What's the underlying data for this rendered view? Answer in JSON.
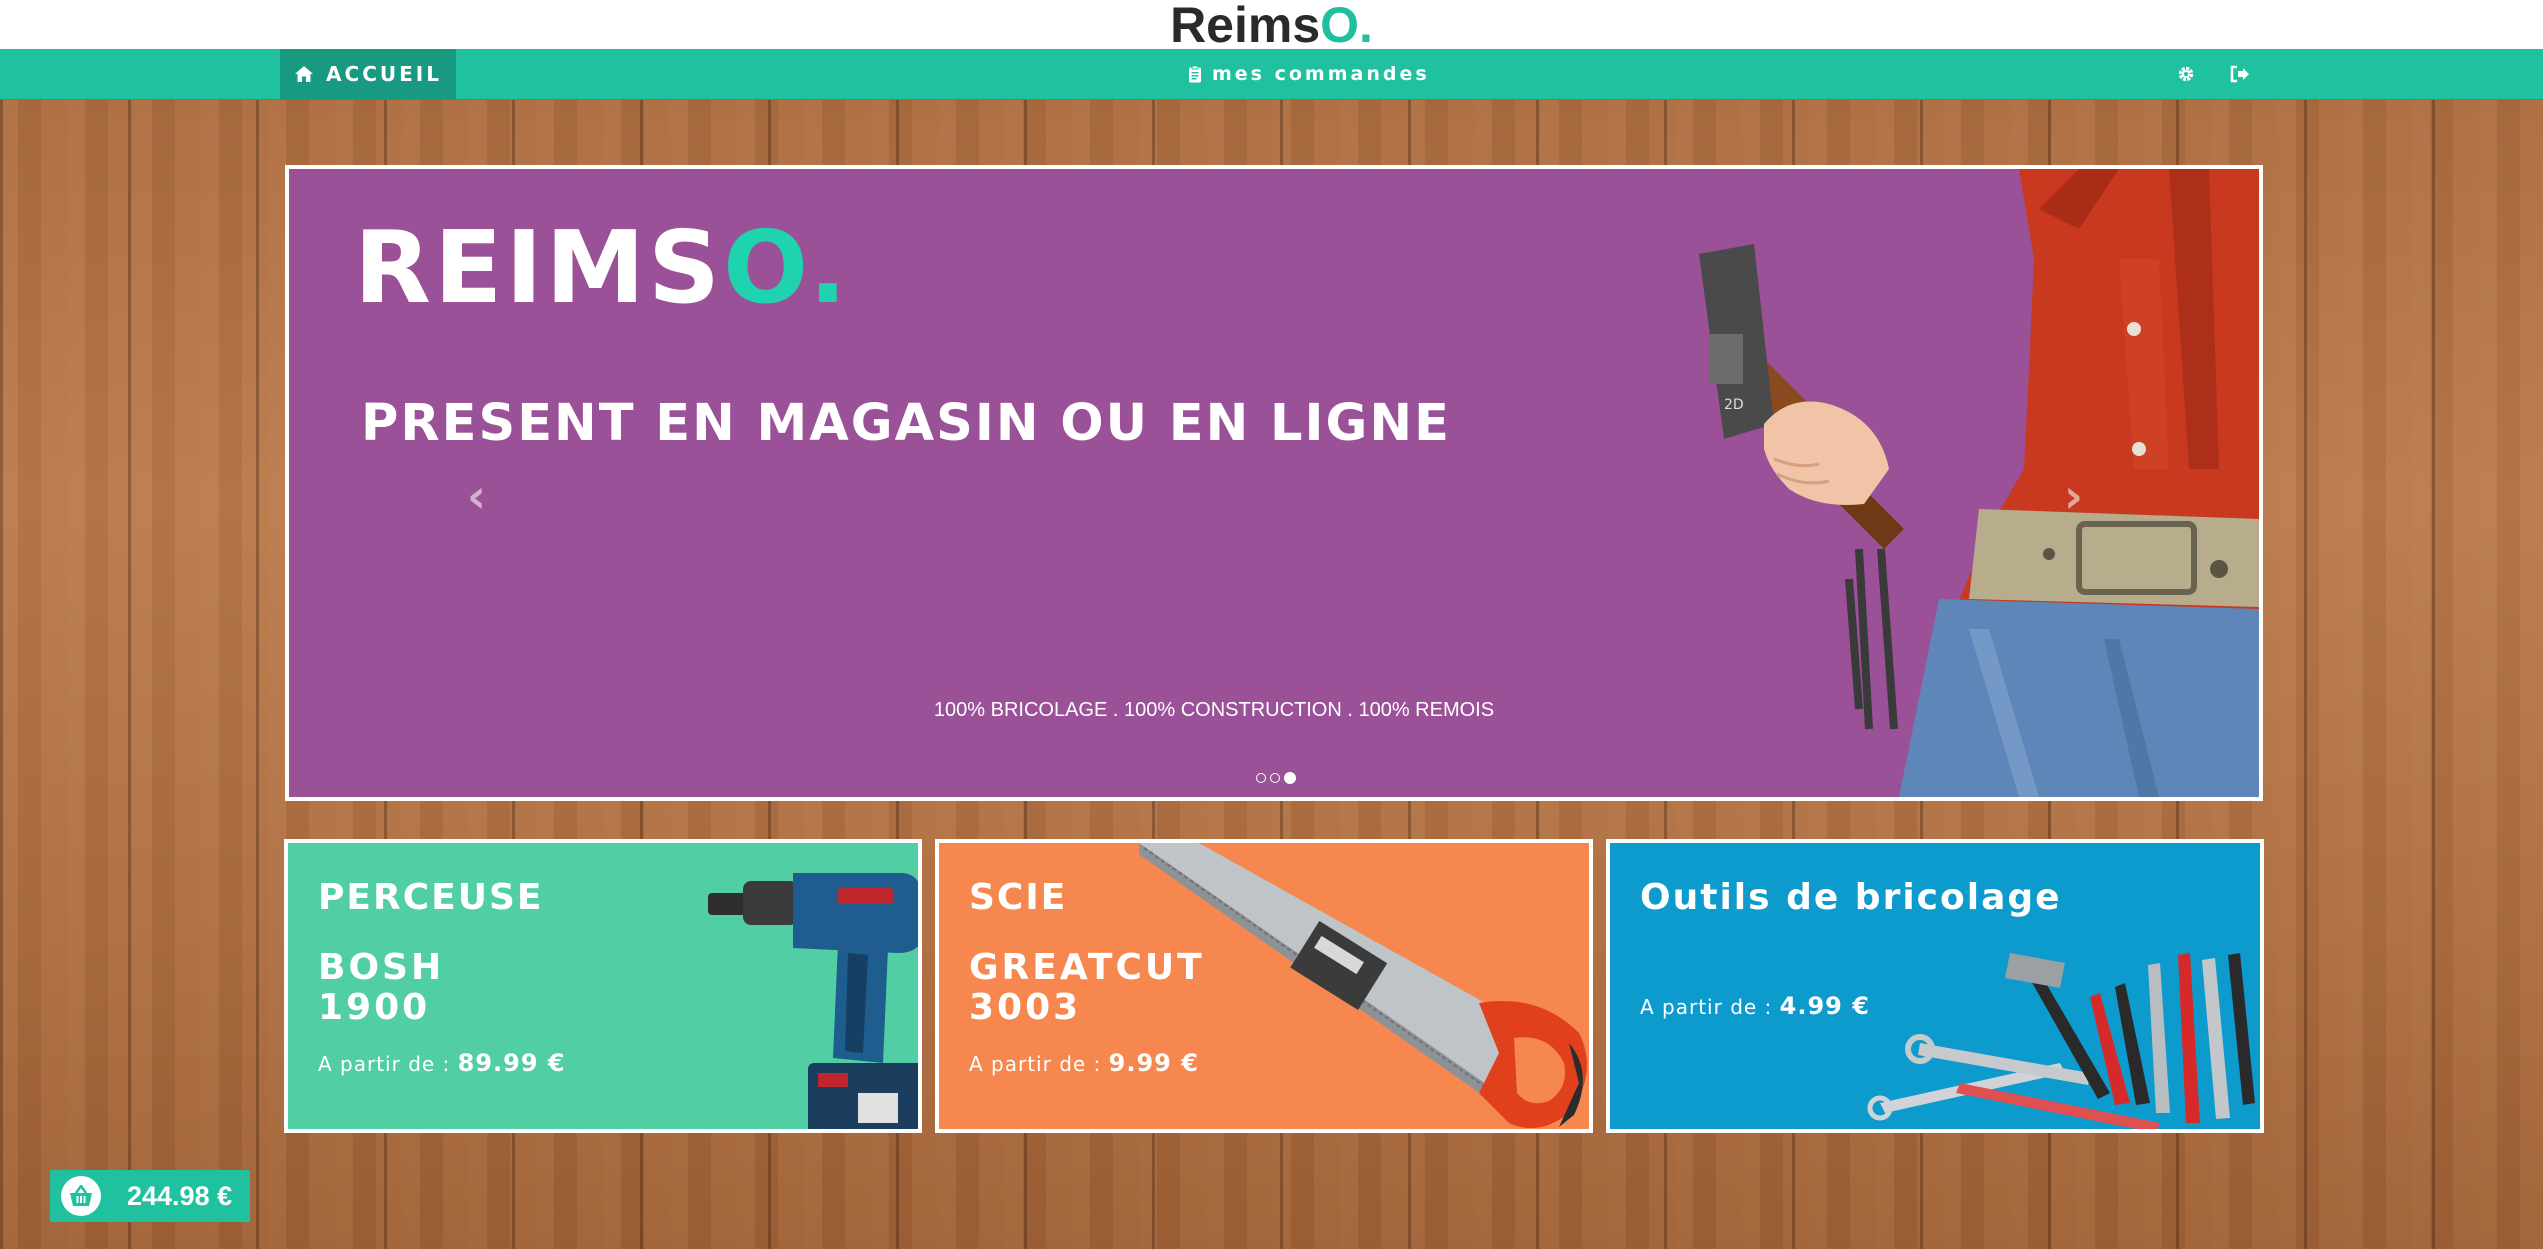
{
  "brand": {
    "name": "Reims",
    "accent": "O."
  },
  "nav": {
    "home_label": "ACCUEIL",
    "orders_label": "mes commandes",
    "settings_icon": "gear-icon",
    "logout_icon": "sign-out-icon"
  },
  "carousel": {
    "logo_main": "REIMS",
    "logo_accent": "O.",
    "headline": "PRESENT EN MAGASIN OU EN LIGNE",
    "tagline": "100% BRICOLAGE . 100% CONSTRUCTION . 100% REMOIS",
    "prev_glyph": "‹",
    "next_glyph": "›",
    "active_slide": 3,
    "slide_count": 3
  },
  "tiles": [
    {
      "title": "PERCEUSE",
      "model_line1": "BOSH",
      "model_line2": "1900",
      "price_prefix": "A partir de :",
      "price": "89.99 €",
      "color": "#52cea5",
      "image": "drill-image"
    },
    {
      "title": "SCIE",
      "model_line1": "GREATCUT",
      "model_line2": "3003",
      "price_prefix": "A partir de :",
      "price": "9.99 €",
      "color": "#f5874f",
      "image": "handsaw-image"
    },
    {
      "title": "Outils de bricolage",
      "price_prefix": "A partir de :",
      "price": "4.99 €",
      "color": "#0d9acd",
      "image": "tools-image"
    }
  ],
  "cart": {
    "total": "244.98 €",
    "icon": "basket-icon"
  },
  "colors": {
    "accent": "#1fc19f",
    "carousel_bg": "#9a5197"
  }
}
